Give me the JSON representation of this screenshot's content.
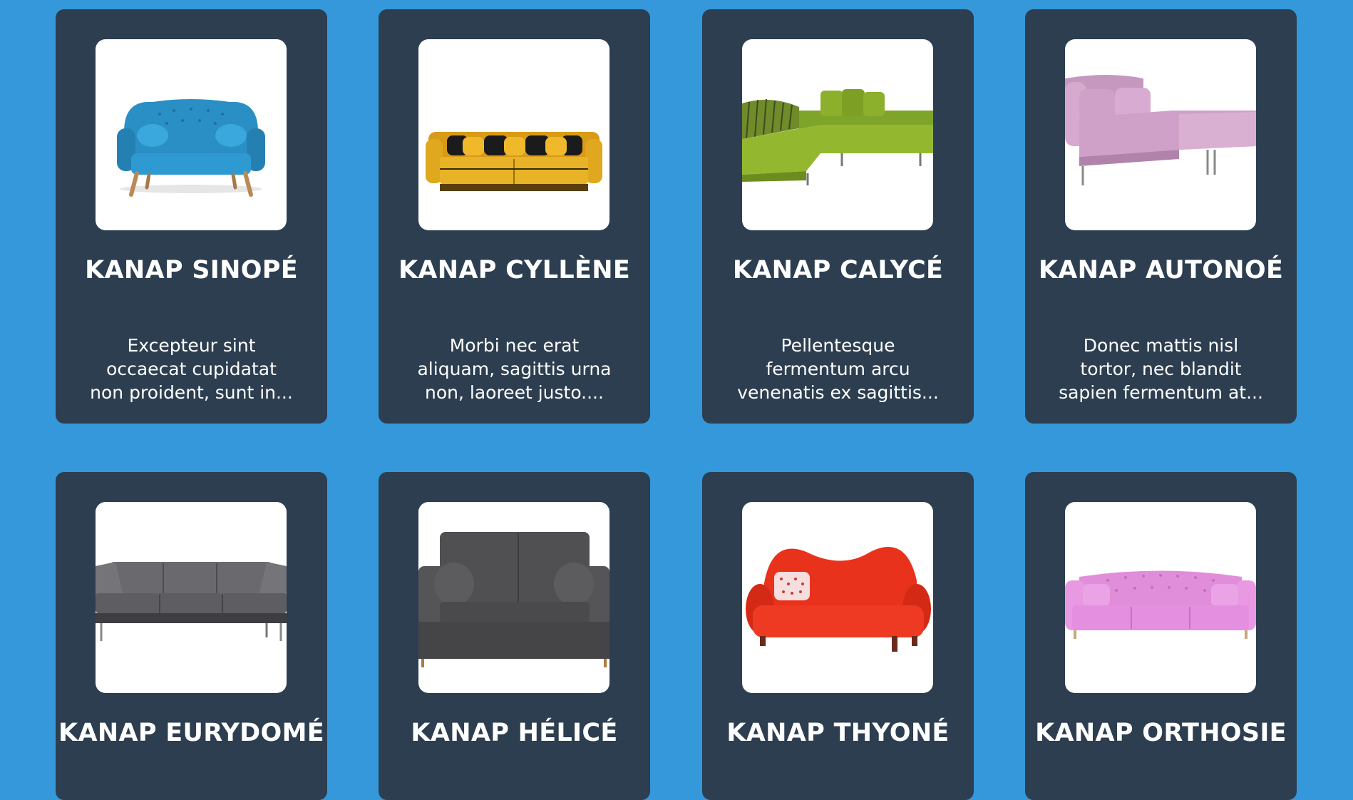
{
  "products": [
    {
      "name": "KANAP SINOPÉ",
      "description_lines": [
        "Excepteur sint",
        "occaecat cupidatat",
        "non proident, sunt in..."
      ],
      "image_alt": "Blue tufted sofa with wooden legs",
      "sofa_color": "#2a8fc4"
    },
    {
      "name": "KANAP CYLLÈNE",
      "description_lines": [
        "Morbi nec erat",
        "aliquam, sagittis urna",
        "non, laoreet justo...."
      ],
      "image_alt": "Yellow sofa with black cushions",
      "sofa_color": "#e0a81e"
    },
    {
      "name": "KANAP CALYCÉ",
      "description_lines": [
        "Pellentesque",
        "fermentum arcu",
        "venenatis ex sagittis..."
      ],
      "image_alt": "Green corner sofa",
      "sofa_color": "#8cb02c"
    },
    {
      "name": "KANAP AUTONOÉ",
      "description_lines": [
        "Donec mattis nisl",
        "tortor, nec blandit",
        "sapien fermentum at..."
      ],
      "image_alt": "Pink chaise sofa",
      "sofa_color": "#cfa0c8"
    },
    {
      "name": "KANAP EURYDOMÉ",
      "description_lines": [],
      "image_alt": "Grey three-seat sofa",
      "sofa_color": "#5e5e62"
    },
    {
      "name": "KANAP HÉLICÉ",
      "description_lines": [],
      "image_alt": "Dark grey two-seat sofa",
      "sofa_color": "#4a4a4c"
    },
    {
      "name": "KANAP THYONÉ",
      "description_lines": [],
      "image_alt": "Red curved sofa with patterned pillow",
      "sofa_color": "#e8321c"
    },
    {
      "name": "KANAP ORTHOSIE",
      "description_lines": [],
      "image_alt": "Pink tufted sofa",
      "sofa_color": "#e58fe0"
    }
  ],
  "colors": {
    "background": "#3498db",
    "card": "#2c3e50",
    "image_frame": "#ffffff",
    "text": "#ffffff"
  }
}
